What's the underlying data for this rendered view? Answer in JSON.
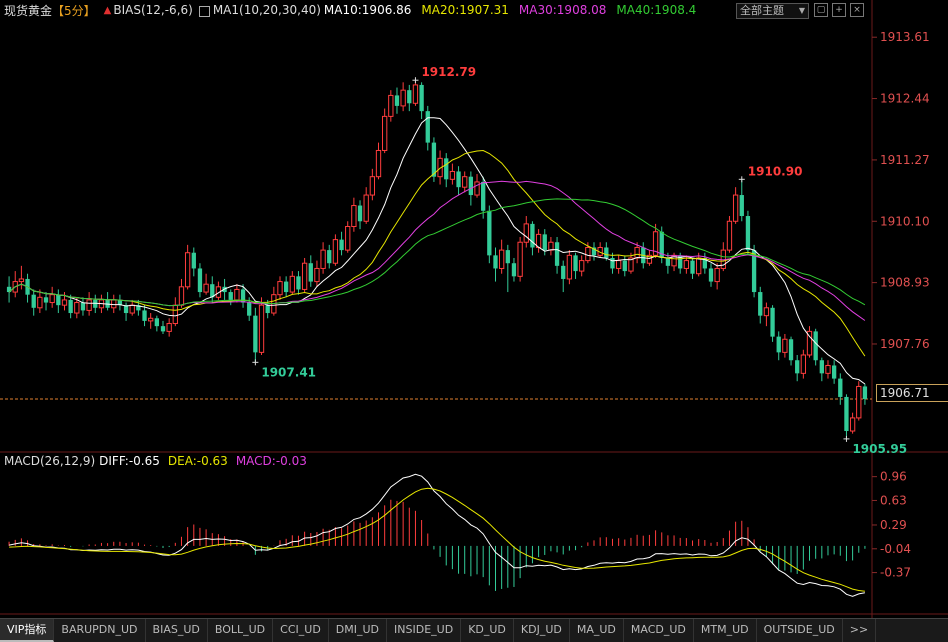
{
  "header": {
    "instrument": "现货黄金",
    "period": "【5分】",
    "bias_label": "BIAS(12,-6,6)",
    "ma_label": "MA1(10,20,30,40)",
    "ma10": "MA10:1906.86",
    "ma20": "MA20:1907.31",
    "ma30": "MA30:1908.08",
    "ma40": "MA40:1908.4",
    "theme_button": "全部主题"
  },
  "macd_header": {
    "label": "MACD(26,12,9)",
    "diff": "DIFF:-0.65",
    "dea": "DEA:-0.63",
    "macd": "MACD:-0.03"
  },
  "current_price": "1906.71",
  "tabs": [
    "VIP指标",
    "BARUPDN_UD",
    "BIAS_UD",
    "BOLL_UD",
    "CCI_UD",
    "DMI_UD",
    "INSIDE_UD",
    "KD_UD",
    "KDJ_UD",
    "MA_UD",
    "MACD_UD",
    "MTM_UD",
    "OUTSIDE_UD",
    ">>"
  ],
  "colors": {
    "up": "#ff3d3d",
    "down": "#33cc99",
    "ma10": "#ffffff",
    "ma20": "#e6e600",
    "ma30": "#e040e0",
    "ma40": "#33cc33",
    "price_axis": "#e05050",
    "grid": "#5a1a1a"
  },
  "chart_data": [
    {
      "type": "candlestick",
      "title": "现货黄金 5分",
      "y_axis_ticks": [
        1913.61,
        1912.44,
        1911.27,
        1910.1,
        1908.93,
        1907.76
      ],
      "ylim": [
        1905.7,
        1913.9
      ],
      "annotations": [
        {
          "label": "1912.79",
          "kind": "high"
        },
        {
          "label": "1907.41",
          "kind": "low"
        },
        {
          "label": "1910.90",
          "kind": "high"
        },
        {
          "label": "1905.95",
          "kind": "low"
        }
      ],
      "last_price": 1906.71,
      "candles": [
        [
          1908.85,
          1908.75,
          1909.05,
          1908.55
        ],
        [
          1908.75,
          1908.95,
          1909.15,
          1908.65
        ],
        [
          1908.95,
          1909.0,
          1909.25,
          1908.8
        ],
        [
          1909.0,
          1908.7,
          1909.1,
          1908.55
        ],
        [
          1908.7,
          1908.45,
          1908.8,
          1908.3
        ],
        [
          1908.45,
          1908.65,
          1908.8,
          1908.35
        ],
        [
          1908.65,
          1908.55,
          1908.75,
          1908.4
        ],
        [
          1908.55,
          1908.7,
          1908.85,
          1908.45
        ],
        [
          1908.7,
          1908.5,
          1908.8,
          1908.35
        ],
        [
          1908.5,
          1908.6,
          1908.75,
          1908.4
        ],
        [
          1908.6,
          1908.35,
          1908.7,
          1908.25
        ],
        [
          1908.35,
          1908.55,
          1908.65,
          1908.25
        ],
        [
          1908.55,
          1908.4,
          1908.65,
          1908.3
        ],
        [
          1908.4,
          1908.6,
          1908.75,
          1908.3
        ],
        [
          1908.6,
          1908.45,
          1908.7,
          1908.35
        ],
        [
          1908.45,
          1908.6,
          1908.7,
          1908.35
        ],
        [
          1908.6,
          1908.45,
          1908.75,
          1908.4
        ],
        [
          1908.45,
          1908.6,
          1908.7,
          1908.35
        ],
        [
          1908.6,
          1908.5,
          1908.7,
          1908.4
        ],
        [
          1908.5,
          1908.35,
          1908.55,
          1908.2
        ],
        [
          1908.35,
          1908.5,
          1908.6,
          1908.3
        ],
        [
          1908.5,
          1908.4,
          1908.6,
          1908.3
        ],
        [
          1908.4,
          1908.2,
          1908.5,
          1908.1
        ],
        [
          1908.2,
          1908.25,
          1908.35,
          1908.05
        ],
        [
          1908.25,
          1908.1,
          1908.3,
          1908.0
        ],
        [
          1908.1,
          1908.0,
          1908.2,
          1907.95
        ],
        [
          1908.0,
          1908.15,
          1908.25,
          1907.9
        ],
        [
          1908.15,
          1908.5,
          1908.65,
          1908.1
        ],
        [
          1908.5,
          1908.85,
          1909.0,
          1908.45
        ],
        [
          1908.85,
          1909.5,
          1909.65,
          1908.8
        ],
        [
          1909.5,
          1909.2,
          1909.6,
          1909.05
        ],
        [
          1909.2,
          1908.75,
          1909.3,
          1908.65
        ],
        [
          1908.75,
          1908.9,
          1909.1,
          1908.7
        ],
        [
          1908.9,
          1908.65,
          1909.05,
          1908.55
        ],
        [
          1908.65,
          1908.85,
          1908.95,
          1908.6
        ],
        [
          1908.85,
          1908.75,
          1909.0,
          1908.6
        ],
        [
          1908.75,
          1908.6,
          1908.8,
          1908.5
        ],
        [
          1908.6,
          1908.8,
          1908.9,
          1908.55
        ],
        [
          1908.8,
          1908.55,
          1908.9,
          1908.45
        ],
        [
          1908.55,
          1908.3,
          1908.65,
          1908.2
        ],
        [
          1908.3,
          1907.6,
          1908.45,
          1907.41
        ],
        [
          1907.6,
          1908.5,
          1908.65,
          1907.55
        ],
        [
          1908.5,
          1908.35,
          1908.6,
          1908.25
        ],
        [
          1908.35,
          1908.7,
          1908.85,
          1908.3
        ],
        [
          1908.7,
          1908.95,
          1909.05,
          1908.6
        ],
        [
          1908.95,
          1908.75,
          1909.05,
          1908.65
        ],
        [
          1908.75,
          1909.05,
          1909.15,
          1908.7
        ],
        [
          1909.05,
          1908.8,
          1909.15,
          1908.7
        ],
        [
          1908.8,
          1909.3,
          1909.4,
          1908.75
        ],
        [
          1909.3,
          1908.95,
          1909.45,
          1908.85
        ],
        [
          1908.95,
          1909.2,
          1909.35,
          1908.85
        ],
        [
          1909.2,
          1909.55,
          1909.7,
          1909.1
        ],
        [
          1909.55,
          1909.3,
          1909.65,
          1909.2
        ],
        [
          1909.3,
          1909.75,
          1909.85,
          1909.25
        ],
        [
          1909.75,
          1909.55,
          1909.9,
          1909.45
        ],
        [
          1909.55,
          1910.0,
          1910.1,
          1909.5
        ],
        [
          1910.0,
          1910.4,
          1910.55,
          1909.9
        ],
        [
          1910.4,
          1910.1,
          1910.5,
          1909.95
        ],
        [
          1910.1,
          1910.6,
          1910.75,
          1910.05
        ],
        [
          1910.6,
          1910.95,
          1911.1,
          1910.5
        ],
        [
          1910.95,
          1911.45,
          1911.6,
          1910.9
        ],
        [
          1911.45,
          1912.1,
          1912.25,
          1911.4
        ],
        [
          1912.1,
          1912.5,
          1912.6,
          1912.0
        ],
        [
          1912.5,
          1912.3,
          1912.65,
          1912.15
        ],
        [
          1912.3,
          1912.6,
          1912.75,
          1912.2
        ],
        [
          1912.6,
          1912.35,
          1912.7,
          1912.2
        ],
        [
          1912.35,
          1912.7,
          1912.79,
          1912.3
        ],
        [
          1912.7,
          1912.2,
          1912.75,
          1912.05
        ],
        [
          1912.2,
          1911.6,
          1912.3,
          1911.45
        ],
        [
          1911.6,
          1910.95,
          1911.7,
          1910.85
        ],
        [
          1910.95,
          1911.3,
          1911.45,
          1910.8
        ],
        [
          1911.3,
          1910.9,
          1911.4,
          1910.75
        ],
        [
          1910.9,
          1911.05,
          1911.2,
          1910.8
        ],
        [
          1911.05,
          1910.75,
          1911.15,
          1910.6
        ],
        [
          1910.75,
          1910.95,
          1911.05,
          1910.65
        ],
        [
          1910.95,
          1910.6,
          1911.05,
          1910.4
        ],
        [
          1910.6,
          1910.85,
          1911.0,
          1910.55
        ],
        [
          1910.85,
          1910.3,
          1910.95,
          1910.15
        ],
        [
          1910.3,
          1909.45,
          1910.4,
          1909.3
        ],
        [
          1909.45,
          1909.2,
          1909.6,
          1908.95
        ],
        [
          1909.2,
          1909.55,
          1909.75,
          1909.1
        ],
        [
          1909.55,
          1909.3,
          1909.65,
          1908.75
        ],
        [
          1909.3,
          1909.05,
          1909.4,
          1908.95
        ],
        [
          1909.05,
          1909.7,
          1909.8,
          1908.95
        ],
        [
          1909.7,
          1910.05,
          1910.2,
          1909.6
        ],
        [
          1910.05,
          1909.6,
          1910.1,
          1909.45
        ],
        [
          1909.6,
          1909.85,
          1909.95,
          1909.5
        ],
        [
          1909.85,
          1909.55,
          1909.95,
          1909.45
        ],
        [
          1909.55,
          1909.7,
          1909.8,
          1909.45
        ],
        [
          1909.7,
          1909.25,
          1909.8,
          1909.1
        ],
        [
          1909.25,
          1909.0,
          1909.35,
          1908.75
        ],
        [
          1909.0,
          1909.45,
          1909.55,
          1908.9
        ],
        [
          1909.45,
          1909.15,
          1909.5,
          1909.0
        ],
        [
          1909.15,
          1909.35,
          1909.45,
          1909.05
        ],
        [
          1909.35,
          1909.6,
          1909.7,
          1909.3
        ],
        [
          1909.6,
          1909.45,
          1909.7,
          1909.35
        ],
        [
          1909.45,
          1909.6,
          1909.7,
          1909.4
        ],
        [
          1909.6,
          1909.4,
          1909.7,
          1909.35
        ],
        [
          1909.4,
          1909.2,
          1909.5,
          1909.1
        ],
        [
          1909.2,
          1909.35,
          1909.45,
          1909.1
        ],
        [
          1909.35,
          1909.15,
          1909.45,
          1909.05
        ],
        [
          1909.15,
          1909.4,
          1909.5,
          1909.1
        ],
        [
          1909.4,
          1909.6,
          1909.7,
          1909.3
        ],
        [
          1909.6,
          1909.3,
          1909.7,
          1909.2
        ],
        [
          1909.3,
          1909.45,
          1909.55,
          1909.25
        ],
        [
          1909.45,
          1909.9,
          1910.05,
          1909.4
        ],
        [
          1909.9,
          1909.4,
          1910.0,
          1909.3
        ],
        [
          1909.4,
          1909.25,
          1909.5,
          1909.1
        ],
        [
          1909.25,
          1909.45,
          1909.5,
          1909.15
        ],
        [
          1909.45,
          1909.2,
          1909.5,
          1909.1
        ],
        [
          1909.2,
          1909.35,
          1909.45,
          1909.1
        ],
        [
          1909.35,
          1909.1,
          1909.4,
          1909.0
        ],
        [
          1909.1,
          1909.4,
          1909.5,
          1909.05
        ],
        [
          1909.4,
          1909.2,
          1909.5,
          1909.1
        ],
        [
          1909.2,
          1908.95,
          1909.3,
          1908.85
        ],
        [
          1908.95,
          1909.2,
          1909.3,
          1908.8
        ],
        [
          1909.2,
          1909.55,
          1909.7,
          1909.15
        ],
        [
          1909.55,
          1910.1,
          1910.2,
          1909.5
        ],
        [
          1910.1,
          1910.6,
          1910.75,
          1910.05
        ],
        [
          1910.6,
          1910.2,
          1910.9,
          1910.1
        ],
        [
          1910.2,
          1909.55,
          1910.3,
          1909.45
        ],
        [
          1909.55,
          1908.75,
          1909.65,
          1908.65
        ],
        [
          1908.75,
          1908.3,
          1908.85,
          1908.15
        ],
        [
          1908.3,
          1908.45,
          1908.55,
          1908.1
        ],
        [
          1908.45,
          1907.9,
          1908.5,
          1907.8
        ],
        [
          1907.9,
          1907.6,
          1908.0,
          1907.45
        ],
        [
          1907.6,
          1907.85,
          1907.95,
          1907.5
        ],
        [
          1907.85,
          1907.45,
          1907.9,
          1907.35
        ],
        [
          1907.45,
          1907.2,
          1907.55,
          1907.05
        ],
        [
          1907.2,
          1907.55,
          1907.65,
          1907.1
        ],
        [
          1907.55,
          1908.0,
          1908.1,
          1907.5
        ],
        [
          1908.0,
          1907.45,
          1908.05,
          1907.35
        ],
        [
          1907.45,
          1907.2,
          1907.5,
          1907.05
        ],
        [
          1907.2,
          1907.35,
          1907.45,
          1907.1
        ],
        [
          1907.35,
          1907.1,
          1907.45,
          1907.0
        ],
        [
          1907.1,
          1906.75,
          1907.2,
          1906.6
        ],
        [
          1906.75,
          1906.1,
          1906.8,
          1905.95
        ],
        [
          1906.1,
          1906.35,
          1906.45,
          1906.05
        ],
        [
          1906.35,
          1906.95,
          1907.05,
          1906.3
        ],
        [
          1906.95,
          1906.71,
          1907.0,
          1906.6
        ]
      ]
    },
    {
      "type": "macd",
      "title": "MACD(26,12,9)",
      "y_axis_ticks": [
        0.96,
        0.63,
        0.29,
        -0.04,
        -0.37
      ],
      "ylim": [
        -0.75,
        1.08
      ],
      "diff": -0.65,
      "dea": -0.63,
      "macd": -0.03
    }
  ]
}
